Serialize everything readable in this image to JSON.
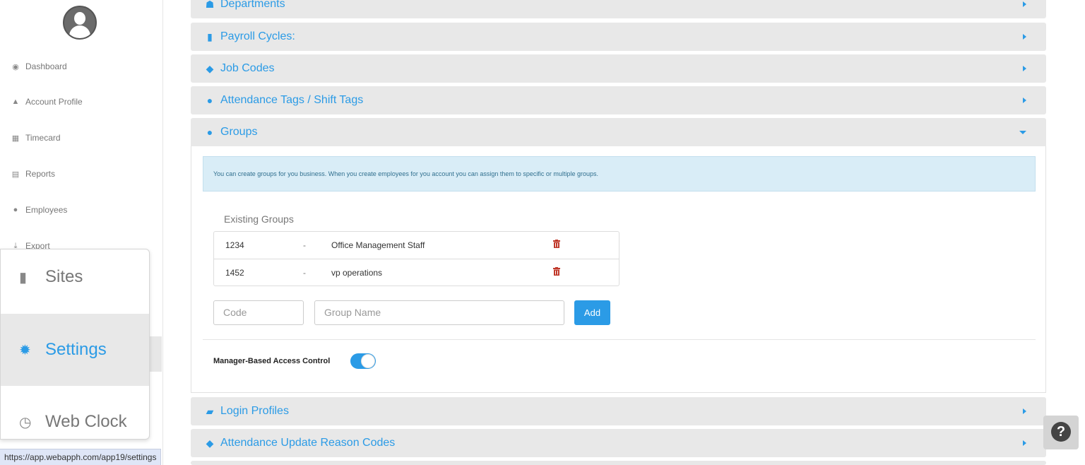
{
  "sidebar": {
    "items": [
      {
        "label": "Dashboard",
        "icon": "dashboard-icon"
      },
      {
        "label": "Account Profile",
        "icon": "user-icon"
      },
      {
        "label": "Timecard",
        "icon": "table-icon"
      },
      {
        "label": "Reports",
        "icon": "list-icon"
      },
      {
        "label": "Employees",
        "icon": "users-icon"
      },
      {
        "label": "Export",
        "icon": "download-icon"
      }
    ]
  },
  "popup_menu": {
    "items": [
      {
        "label": "Sites",
        "icon": "building-icon"
      },
      {
        "label": "Settings",
        "icon": "gear-icon",
        "selected": true
      },
      {
        "label": "Web Clock",
        "icon": "clock-icon"
      }
    ]
  },
  "status_url": "https://app.webapph.com/app19/settings",
  "panels": [
    {
      "label": "Departments",
      "icon": "sitemap-icon",
      "expanded": false
    },
    {
      "label": "Payroll Cycles:",
      "icon": "building-icon",
      "expanded": false
    },
    {
      "label": "Job Codes",
      "icon": "tags-icon",
      "expanded": false
    },
    {
      "label": "Attendance Tags / Shift Tags",
      "icon": "users-icon",
      "expanded": false
    },
    {
      "label": "Groups",
      "icon": "users-icon",
      "expanded": true
    },
    {
      "label": "Login Profiles",
      "icon": "briefcase-icon",
      "expanded": false
    },
    {
      "label": "Attendance Update Reason Codes",
      "icon": "tag-icon",
      "expanded": false
    }
  ],
  "groups": {
    "info": "You can create groups for you business. When you create employees for you account you can assign them to specific or multiple groups.",
    "existing_title": "Existing Groups",
    "separator": "-",
    "rows": [
      {
        "code": "1234",
        "name": "Office Management Staff"
      },
      {
        "code": "1452",
        "name": "vp operations"
      }
    ],
    "code_placeholder": "Code",
    "name_placeholder": "Group Name",
    "add_label": "Add",
    "access_control_label": "Manager-Based Access Control",
    "access_control_on": true
  },
  "help_label": "?",
  "colors": {
    "accent": "#2b9be6",
    "panel_bg": "#e8e8e8",
    "info_bg": "#d9edf7",
    "delete": "#c0392b"
  }
}
